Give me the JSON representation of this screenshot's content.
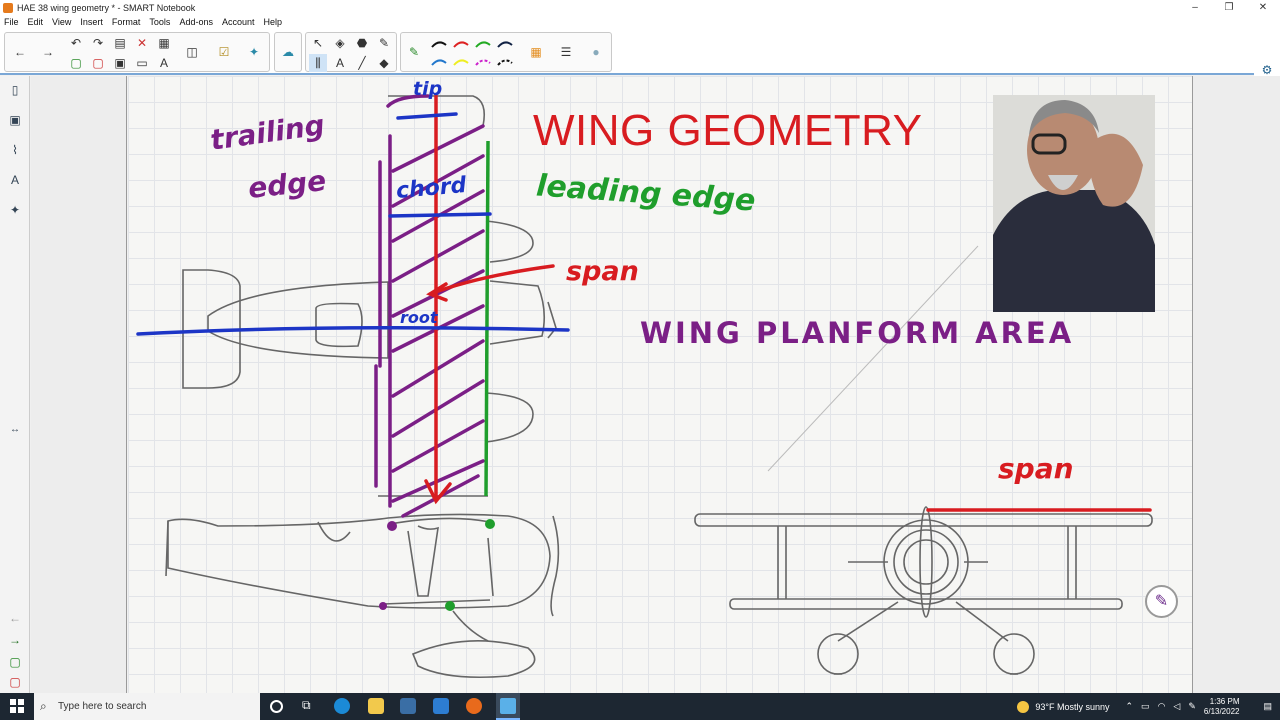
{
  "window": {
    "title": "HAE 38 wing geometry * - SMART Notebook",
    "controls": [
      "–",
      "❐",
      "✕"
    ]
  },
  "menu": [
    "File",
    "Edit",
    "View",
    "Insert",
    "Format",
    "Tools",
    "Add-ons",
    "Account",
    "Help"
  ],
  "canvas": {
    "title": "WING GEOMETRY",
    "labels": {
      "tip": "tip",
      "trailing_edge_1": "trailing",
      "trailing_edge_2": "edge",
      "chord": "chord",
      "leading_edge": "leading edge",
      "span_top": "span",
      "root": "root",
      "planform": "WING  PLANFORM  AREA",
      "span_bottom": "span"
    }
  },
  "taskbar": {
    "search_placeholder": "Type here to search",
    "weather": "93°F  Mostly sunny",
    "time": "1:36 PM",
    "date": "6/13/2022"
  },
  "colors": {
    "red": "#d81c20",
    "purple": "#7b1f86",
    "blue": "#1c35c6",
    "green": "#1f9e2c",
    "bg": "#f6f6f4"
  }
}
